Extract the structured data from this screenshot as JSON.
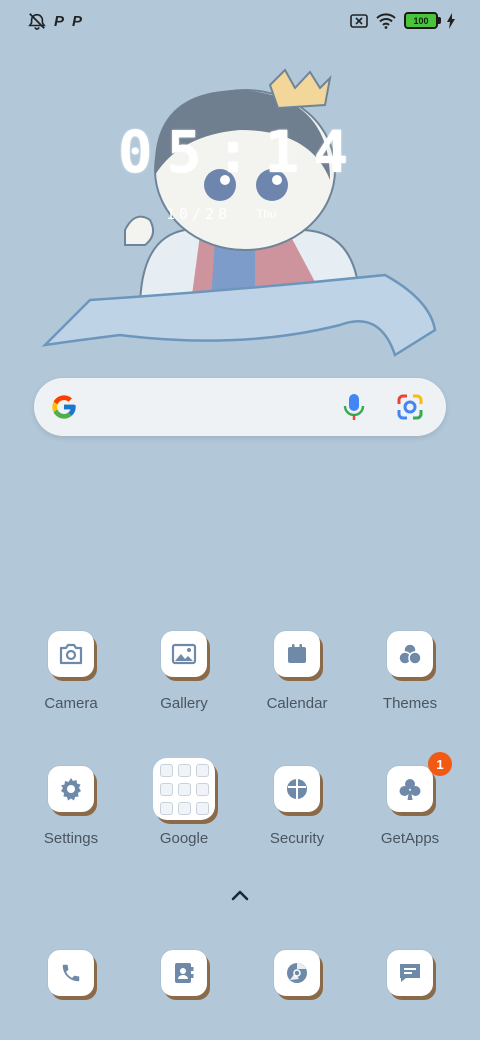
{
  "status": {
    "left_icons": [
      "alarm-off-icon",
      "p-notification-icon",
      "p-notification-icon"
    ],
    "p1": "P",
    "p2": "P",
    "battery": "100"
  },
  "clock": {
    "time": "05:14",
    "date": "10/28",
    "day": "Thu"
  },
  "search": {
    "placeholder": ""
  },
  "apps_row1": [
    {
      "label": "Camera",
      "icon": "camera-icon"
    },
    {
      "label": "Gallery",
      "icon": "gallery-icon"
    },
    {
      "label": "Calendar",
      "icon": "calendar-icon"
    },
    {
      "label": "Themes",
      "icon": "themes-icon"
    }
  ],
  "apps_row2": [
    {
      "label": "Settings",
      "icon": "gear-icon"
    },
    {
      "label": "Google",
      "icon": "folder-icon"
    },
    {
      "label": "Security",
      "icon": "shield-icon"
    },
    {
      "label": "GetApps",
      "icon": "club-icon",
      "badge": "1"
    }
  ],
  "dock": [
    {
      "icon": "phone-icon"
    },
    {
      "icon": "contacts-icon"
    },
    {
      "icon": "browser-icon"
    },
    {
      "icon": "messages-icon"
    }
  ],
  "colors": {
    "background": "#b2c8d9",
    "icon": "#6f8aa8",
    "badge": "#f25a14",
    "battery": "#4bc43d"
  }
}
